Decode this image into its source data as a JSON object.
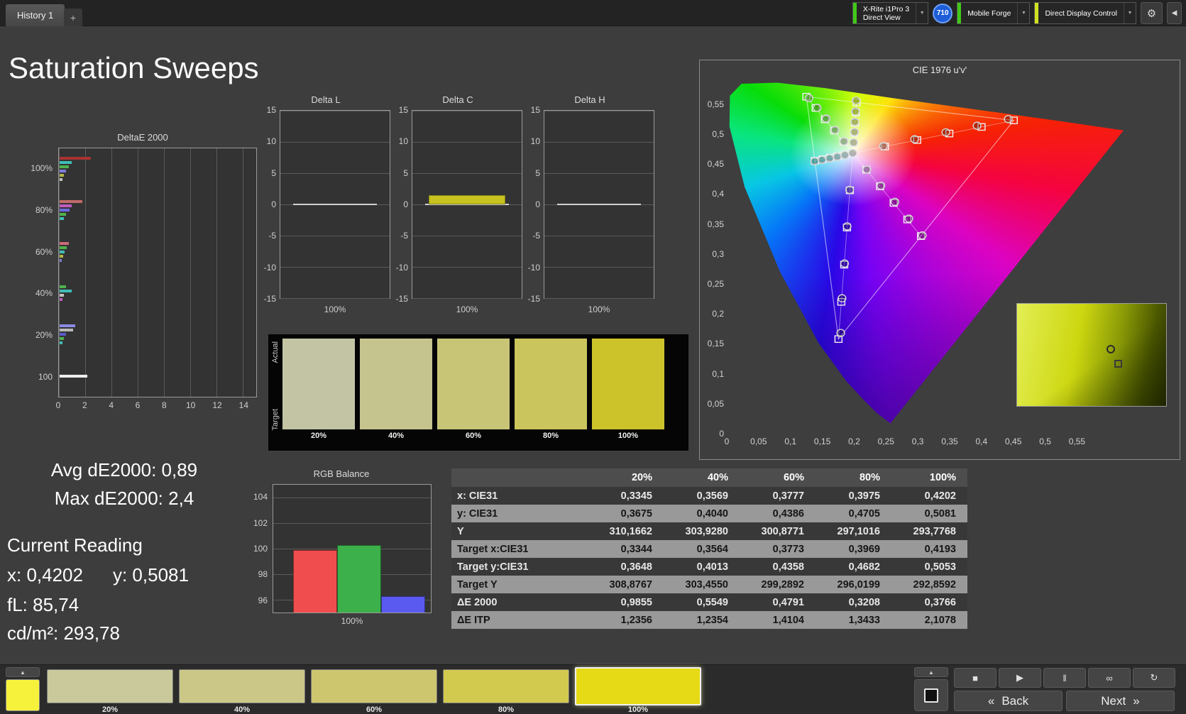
{
  "topbar": {
    "history_tab": "History 1",
    "add_tab": "+",
    "meter": {
      "line1": "X-Rite i1Pro 3",
      "line2": "Direct View"
    },
    "meter_badge": "710",
    "source": "Mobile Forge",
    "display_control": "Direct Display Control"
  },
  "status_colors": {
    "meter": "#42c818",
    "source": "#42c818",
    "display_control": "#cfe020"
  },
  "page_title": "Saturation Sweeps",
  "icons": {
    "up": "▲",
    "stop": "■",
    "play": "▶",
    "pause": "‖",
    "infinity": "∞",
    "refresh": "↻",
    "gear": "⚙",
    "collapse": "◀",
    "dropdown": "▼"
  },
  "deltae_chart": {
    "title": "DeltaE 2000",
    "x_ticks": [
      0,
      2,
      4,
      6,
      8,
      10,
      12,
      14
    ],
    "x_max": 15,
    "groups": [
      {
        "label": "100%",
        "bars": [
          {
            "color": "#a83232",
            "value": 2.4
          },
          {
            "color": "#3fbdb4",
            "value": 0.95
          },
          {
            "color": "#4fb24f",
            "value": 0.68
          },
          {
            "color": "#7d7dd8",
            "value": 0.5
          },
          {
            "color": "#b4b44a",
            "value": 0.34
          },
          {
            "color": "#bfbfbf",
            "value": 0.22
          }
        ]
      },
      {
        "label": "80%",
        "bars": [
          {
            "color": "#c36a6a",
            "value": 1.75
          },
          {
            "color": "#c05cc0",
            "value": 0.9
          },
          {
            "color": "#6a6ae0",
            "value": 0.74
          },
          {
            "color": "#4fb24f",
            "value": 0.5
          },
          {
            "color": "#3fbdb4",
            "value": 0.33
          }
        ]
      },
      {
        "label": "60%",
        "bars": [
          {
            "color": "#cf6a7a",
            "value": 0.72
          },
          {
            "color": "#4fb24f",
            "value": 0.55
          },
          {
            "color": "#3fbdb4",
            "value": 0.4
          },
          {
            "color": "#b4b44a",
            "value": 0.26
          },
          {
            "color": "#7d7dd8",
            "value": 0.18
          }
        ]
      },
      {
        "label": "40%",
        "bars": [
          {
            "color": "#4fb24f",
            "value": 0.5
          },
          {
            "color": "#3fbdb4",
            "value": 0.92
          },
          {
            "color": "#bfbfbf",
            "value": 0.3
          },
          {
            "color": "#c05cc0",
            "value": 0.22
          }
        ]
      },
      {
        "label": "20%",
        "bars": [
          {
            "color": "#8a8ae6",
            "value": 1.2
          },
          {
            "color": "#b9b9b9",
            "value": 1.05
          },
          {
            "color": "#5a5ac8",
            "value": 0.5
          },
          {
            "color": "#4fb24f",
            "value": 0.3
          },
          {
            "color": "#3fbdb4",
            "value": 0.2
          }
        ]
      },
      {
        "label": "100",
        "bars": [
          {
            "color": "#ededed",
            "value": 2.1
          }
        ]
      }
    ]
  },
  "delta_axis": {
    "y_ticks": [
      15,
      10,
      5,
      0,
      -5,
      -10,
      -15
    ],
    "y_max": 15,
    "x_label": "100%"
  },
  "delta_charts": [
    {
      "title": "Delta L",
      "value": 0,
      "bar_color": "#c6c21f"
    },
    {
      "title": "Delta C",
      "value": 1.5,
      "bar_color": "#c6c21f"
    },
    {
      "title": "Delta H",
      "value": 0,
      "bar_color": "#c6c21f"
    }
  ],
  "swatch_panel": {
    "row_labels": [
      "Actual",
      "Target"
    ],
    "swatches": [
      {
        "label": "20%",
        "color": "#c3c4a4"
      },
      {
        "label": "40%",
        "color": "#c6c48e"
      },
      {
        "label": "60%",
        "color": "#c8c577"
      },
      {
        "label": "80%",
        "color": "#cac55c"
      },
      {
        "label": "100%",
        "color": "#ccc32b"
      }
    ]
  },
  "cie": {
    "title": "CIE 1976 u'v'",
    "x_tick_labels": [
      "0",
      "0,05",
      "0,1",
      "0,15",
      "0,2",
      "0,25",
      "0,3",
      "0,35",
      "0,4",
      "0,45",
      "0,5",
      "0,55"
    ],
    "y_tick_labels": [
      "0,55",
      "0,5",
      "0,45",
      "0,4",
      "0,35",
      "0,3",
      "0,25",
      "0,2",
      "0,15",
      "0,1",
      "0,05",
      "0"
    ],
    "white_point": [
      0.1978,
      0.4683
    ],
    "gamut_triangle": [
      [
        0.4507,
        0.5229
      ],
      [
        0.125,
        0.5625
      ],
      [
        0.1754,
        0.1579
      ]
    ],
    "sweeps": [
      {
        "name": "yellow",
        "target": [
          [
            0.199,
            0.4852
          ],
          [
            0.2002,
            0.5021
          ],
          [
            0.2015,
            0.519
          ],
          [
            0.2027,
            0.5359
          ],
          [
            0.2039,
            0.5528
          ]
        ],
        "measured": [
          [
            0.1992,
            0.486
          ],
          [
            0.2006,
            0.5035
          ],
          [
            0.201,
            0.5205
          ],
          [
            0.202,
            0.538
          ],
          [
            0.203,
            0.556
          ]
        ]
      },
      {
        "name": "red",
        "target": [
          [
            0.2484,
            0.4792
          ],
          [
            0.299,
            0.4901
          ],
          [
            0.3495,
            0.501
          ],
          [
            0.4001,
            0.512
          ],
          [
            0.4507,
            0.5229
          ]
        ],
        "measured": [
          [
            0.246,
            0.48
          ],
          [
            0.295,
            0.4915
          ],
          [
            0.344,
            0.503
          ],
          [
            0.393,
            0.514
          ],
          [
            0.442,
            0.525
          ]
        ]
      },
      {
        "name": "green",
        "target": [
          [
            0.1832,
            0.4871
          ],
          [
            0.1687,
            0.506
          ],
          [
            0.1541,
            0.5248
          ],
          [
            0.1396,
            0.5437
          ],
          [
            0.125,
            0.5625
          ]
        ],
        "measured": [
          [
            0.184,
            0.488
          ],
          [
            0.17,
            0.507
          ],
          [
            0.156,
            0.526
          ],
          [
            0.142,
            0.544
          ],
          [
            0.129,
            0.56
          ]
        ]
      },
      {
        "name": "blue",
        "target": [
          [
            0.1933,
            0.4062
          ],
          [
            0.1888,
            0.3441
          ],
          [
            0.1844,
            0.2821
          ],
          [
            0.1799,
            0.22
          ],
          [
            0.1754,
            0.1579
          ]
        ],
        "measured": [
          [
            0.193,
            0.407
          ],
          [
            0.189,
            0.346
          ],
          [
            0.185,
            0.284
          ],
          [
            0.181,
            0.226
          ],
          [
            0.179,
            0.168
          ]
        ]
      },
      {
        "name": "cyan",
        "target": [
          [
            0.1859,
            0.4657
          ],
          [
            0.174,
            0.4631
          ],
          [
            0.1621,
            0.4606
          ],
          [
            0.1502,
            0.458
          ],
          [
            0.1383,
            0.4554
          ]
        ],
        "measured": [
          [
            0.1855,
            0.465
          ],
          [
            0.1735,
            0.462
          ],
          [
            0.1615,
            0.4595
          ],
          [
            0.1495,
            0.4568
          ],
          [
            0.138,
            0.4545
          ]
        ]
      },
      {
        "name": "magenta",
        "target": [
          [
            0.2192,
            0.4406
          ],
          [
            0.2407,
            0.4129
          ],
          [
            0.2621,
            0.3852
          ],
          [
            0.2836,
            0.3575
          ],
          [
            0.305,
            0.3298
          ]
        ],
        "measured": [
          [
            0.22,
            0.441
          ],
          [
            0.242,
            0.414
          ],
          [
            0.264,
            0.387
          ],
          [
            0.286,
            0.359
          ],
          [
            0.307,
            0.331
          ]
        ]
      }
    ]
  },
  "stats": {
    "avg": "Avg dE2000: 0,89",
    "max": "Max dE2000: 2,4",
    "current_reading": "Current Reading",
    "x": "x: 0,4202",
    "y": "y: 0,5081",
    "fl": "fL: 85,74",
    "cdm2": "cd/m²: 293,78"
  },
  "rgb_balance": {
    "title": "RGB Balance",
    "y_ticks": [
      104,
      102,
      100,
      98,
      96
    ],
    "y_min": 95,
    "y_max": 105,
    "x_label": "100%",
    "bars": [
      {
        "name": "red",
        "value": 99.9,
        "color": "#f04e4e"
      },
      {
        "name": "green",
        "value": 100.3,
        "color": "#3cb04a"
      },
      {
        "name": "blue",
        "value": 96.3,
        "color": "#5a5af0"
      }
    ]
  },
  "table": {
    "columns": [
      "20%",
      "40%",
      "60%",
      "80%",
      "100%"
    ],
    "rows": [
      {
        "label": "x: CIE31",
        "values": [
          "0,3345",
          "0,3569",
          "0,3777",
          "0,3975",
          "0,4202"
        ]
      },
      {
        "label": "y: CIE31",
        "values": [
          "0,3675",
          "0,4040",
          "0,4386",
          "0,4705",
          "0,5081"
        ]
      },
      {
        "label": "Y",
        "values": [
          "310,1662",
          "303,9280",
          "300,8771",
          "297,1016",
          "293,7768"
        ]
      },
      {
        "label": "Target x:CIE31",
        "values": [
          "0,3344",
          "0,3564",
          "0,3773",
          "0,3969",
          "0,4193"
        ]
      },
      {
        "label": "Target y:CIE31",
        "values": [
          "0,3648",
          "0,4013",
          "0,4358",
          "0,4682",
          "0,5053"
        ]
      },
      {
        "label": "Target Y",
        "values": [
          "308,8767",
          "303,4550",
          "299,2892",
          "296,0199",
          "292,8592"
        ]
      },
      {
        "label": "ΔE 2000",
        "values": [
          "0,9855",
          "0,5549",
          "0,4791",
          "0,3208",
          "0,3766"
        ]
      },
      {
        "label": "ΔE ITP",
        "values": [
          "1,2356",
          "1,2354",
          "1,4104",
          "1,3433",
          "2,1078"
        ]
      }
    ]
  },
  "bottom_bar": {
    "current_color": "#f6f23c",
    "swatch_buttons": [
      {
        "label": "20%",
        "color": "#c9c99c",
        "selected": false
      },
      {
        "label": "40%",
        "color": "#cbc787",
        "selected": false
      },
      {
        "label": "60%",
        "color": "#cdc66e",
        "selected": false
      },
      {
        "label": "80%",
        "color": "#d2c94f",
        "selected": false
      },
      {
        "label": "100%",
        "color": "#e6da17",
        "selected": true
      }
    ],
    "back_chevron": "«",
    "back_label": "Back",
    "next_label": "Next",
    "next_chevron": "»"
  }
}
